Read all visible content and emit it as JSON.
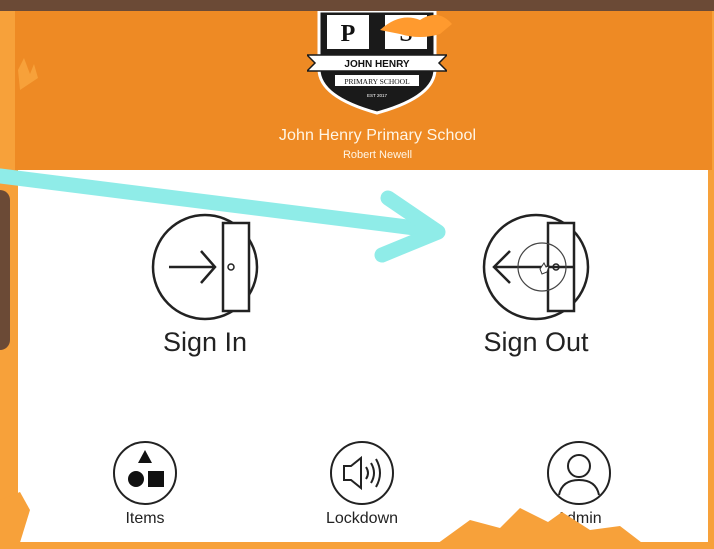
{
  "header": {
    "crest_letters": [
      "P",
      "S"
    ],
    "crest_banner": "JOHN HENRY",
    "crest_subbanner": "PRIMARY SCHOOL",
    "crest_est": "EST 2017",
    "school_name": "John Henry Primary School",
    "user_name": "Robert Newell"
  },
  "actions": {
    "sign_in": {
      "label": "Sign In",
      "icon": "sign-in-door-icon"
    },
    "sign_out": {
      "label": "Sign Out",
      "icon": "sign-out-door-icon"
    }
  },
  "bottom_menu": {
    "items": {
      "label": "Items",
      "icon": "shapes-icon"
    },
    "lockdown": {
      "label": "Lockdown",
      "icon": "speaker-icon"
    },
    "admin": {
      "label": "Admin",
      "icon": "user-icon"
    }
  },
  "colors": {
    "header_bg": "#ee8a24",
    "arrow": "#8fece8",
    "frame": "#6b4a36",
    "icon_stroke": "#222222"
  }
}
